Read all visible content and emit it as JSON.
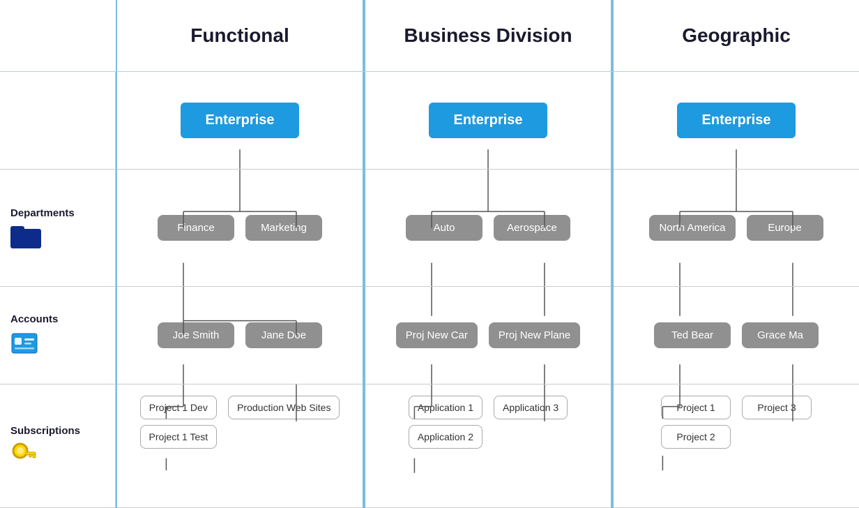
{
  "headers": {
    "functional": "Functional",
    "businessDivision": "Business Division",
    "geographic": "Geographic"
  },
  "labels": {
    "departments": "Departments",
    "accounts": "Accounts",
    "subscriptions": "Subscriptions"
  },
  "columns": {
    "functional": {
      "enterprise": "Enterprise",
      "departments": [
        "Finance",
        "Marketing"
      ],
      "accounts": [
        "Joe Smith",
        "Jane Doe"
      ],
      "subscriptions": {
        "joeSmith": [
          "Project 1 Dev",
          "Project 1 Test"
        ],
        "janeDoe": [
          "Production Web Sites"
        ]
      }
    },
    "businessDivision": {
      "enterprise": "Enterprise",
      "departments": [
        "Auto",
        "Aerospace"
      ],
      "accounts": [
        "Proj New Car",
        "Proj New Plane"
      ],
      "subscriptions": {
        "projNewCar": [
          "Application 1",
          "Application 2"
        ],
        "projNewPlane": [
          "Application 3"
        ]
      }
    },
    "geographic": {
      "enterprise": "Enterprise",
      "departments": [
        "North America",
        "Europe"
      ],
      "accounts": [
        "Ted Bear",
        "Grace Ma"
      ],
      "subscriptions": {
        "tedBear": [
          "Project 1",
          "Project 2"
        ],
        "graceMa": [
          "Project 3"
        ]
      }
    }
  }
}
